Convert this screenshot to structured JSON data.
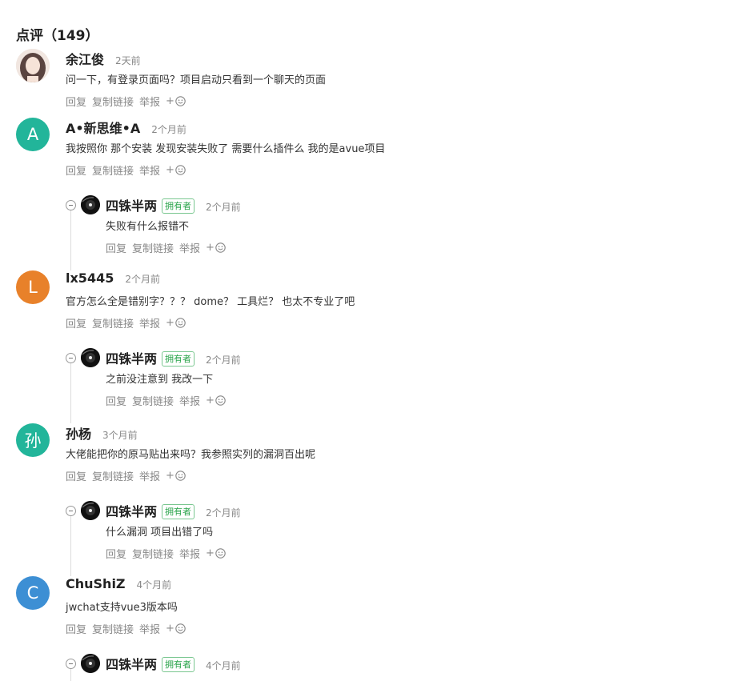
{
  "title": "点评（149）",
  "actions": {
    "reply": "回复",
    "copy_link": "复制链接",
    "report": "举报",
    "emoji": "+"
  },
  "owner_badge": "拥有者",
  "comments": [
    {
      "name": "余江俊",
      "time": "2天前",
      "text": "问一下，有登录页面吗？项目启动只看到一个聊天的页面",
      "avatar_letter": "",
      "avatar_color": "#d8c8c0"
    },
    {
      "name": "A•新思维•A",
      "time": "2个月前",
      "text": "我按照你 那个安装 发现安装失败了 需要什么插件么 我的是avue项目",
      "avatar_letter": "A",
      "avatar_color": "#22b59a",
      "reply": {
        "name": "四铢半两",
        "time": "2个月前",
        "text": "失败有什么报错不"
      }
    },
    {
      "name": "lx5445",
      "time": "2个月前",
      "text": "官方怎么全是错别字？？？ dome？ 工具烂？ 也太不专业了吧",
      "avatar_letter": "L",
      "avatar_color": "#e8812a",
      "reply": {
        "name": "四铢半两",
        "time": "2个月前",
        "text": "之前没注意到 我改一下"
      }
    },
    {
      "name": "孙杨",
      "time": "3个月前",
      "text": "大佬能把你的原马贴出来吗？我参照实列的漏洞百出呢",
      "avatar_letter": "孙",
      "avatar_color": "#22b59a",
      "reply": {
        "name": "四铢半两",
        "time": "2个月前",
        "text": "什么漏洞 项目出错了吗"
      }
    },
    {
      "name": "ChuShiZ",
      "time": "4个月前",
      "text": "jwchat支持vue3版本吗",
      "avatar_letter": "C",
      "avatar_color": "#3d8fd4",
      "reply": {
        "name": "四铢半两",
        "time": "4个月前",
        "text": ""
      }
    }
  ]
}
